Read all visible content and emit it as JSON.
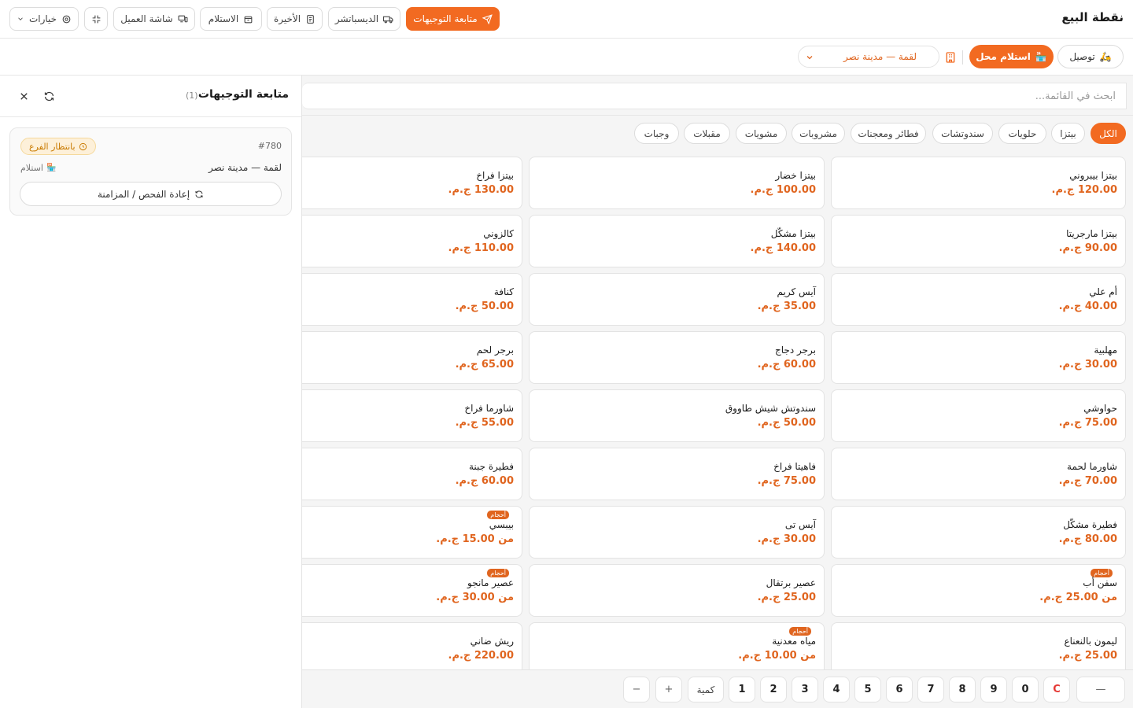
{
  "header": {
    "title": "نقطة البيع",
    "buttons": {
      "routing": "متابعة التوجيهات",
      "dispatcher": "الديسباتشر",
      "recent": "الأخيرة",
      "pickup": "الاستلام",
      "customer_screen": "شاشة العميل",
      "options": "خيارات"
    }
  },
  "order_types": {
    "delivery": "توصيل",
    "pickup": "استلام محل",
    "branch": "لقمة — مدينة نصر"
  },
  "panel": {
    "title": "متابعة التوجيهات",
    "count": "(1)",
    "order": {
      "number": "#780",
      "status": "بانتظار الفرع",
      "branch": "لقمة — مدينة نصر",
      "type": "استلام",
      "recheck": "إعادة الفحص / المزامنة"
    }
  },
  "search": {
    "placeholder": "ابحث في القائمة..."
  },
  "categories": [
    "الكل",
    "بيتزا",
    "حلويات",
    "سندوتشات",
    "فطائر ومعجنات",
    "مشروبات",
    "مشويات",
    "مقبلات",
    "وجبات"
  ],
  "items": [
    {
      "name": "بيتزا بيبروني",
      "price": "120.00 ج.م."
    },
    {
      "name": "بيتزا خضار",
      "price": "100.00 ج.م."
    },
    {
      "name": "بيتزا فراخ",
      "price": "130.00 ج.م."
    },
    {
      "name": "بيتزا مارجريتا",
      "price": "90.00 ج.م."
    },
    {
      "name": "بيتزا مشكّل",
      "price": "140.00 ج.م."
    },
    {
      "name": "كالزوني",
      "price": "110.00 ج.م."
    },
    {
      "name": "أم علي",
      "price": "40.00 ج.م."
    },
    {
      "name": "آيس كريم",
      "price": "35.00 ج.م."
    },
    {
      "name": "كنافة",
      "price": "50.00 ج.م."
    },
    {
      "name": "مهلبية",
      "price": "30.00 ج.م."
    },
    {
      "name": "برجر دجاج",
      "price": "60.00 ج.م."
    },
    {
      "name": "برجر لحم",
      "price": "65.00 ج.م."
    },
    {
      "name": "حواوشي",
      "price": "75.00 ج.م."
    },
    {
      "name": "سندوتش شيش طاووق",
      "price": "50.00 ج.م."
    },
    {
      "name": "شاورما فراخ",
      "price": "55.00 ج.م."
    },
    {
      "name": "شاورما لحمة",
      "price": "70.00 ج.م."
    },
    {
      "name": "فاهيتا فراخ",
      "price": "75.00 ج.م."
    },
    {
      "name": "فطيرة جبنة",
      "price": "60.00 ج.م."
    },
    {
      "name": "فطيرة مشكّل",
      "price": "80.00 ج.م."
    },
    {
      "name": "آيس تى",
      "price": "30.00 ج.م."
    },
    {
      "name": "بيبسي",
      "price": "من 15.00 ج.م.",
      "badge": "أحجام"
    },
    {
      "name": "سفن أب",
      "price": "من 25.00 ج.م.",
      "badge": "أحجام"
    },
    {
      "name": "عصير برتقال",
      "price": "25.00 ج.م."
    },
    {
      "name": "عصير مانجو",
      "price": "من 30.00 ج.م.",
      "badge": "أحجام"
    },
    {
      "name": "ليمون بالنعناع",
      "price": "25.00 ج.م."
    },
    {
      "name": "مياه معدنية",
      "price": "من 10.00 ج.م.",
      "badge": "أحجام"
    },
    {
      "name": "ريش ضاني",
      "price": "220.00 ج.م."
    }
  ],
  "keypad": {
    "backspace": "—",
    "clear": "C",
    "digits": [
      "0",
      "9",
      "8",
      "7",
      "6",
      "5",
      "4",
      "3",
      "2",
      "1"
    ],
    "qty": "كمية",
    "plus": "+",
    "minus": "−"
  }
}
